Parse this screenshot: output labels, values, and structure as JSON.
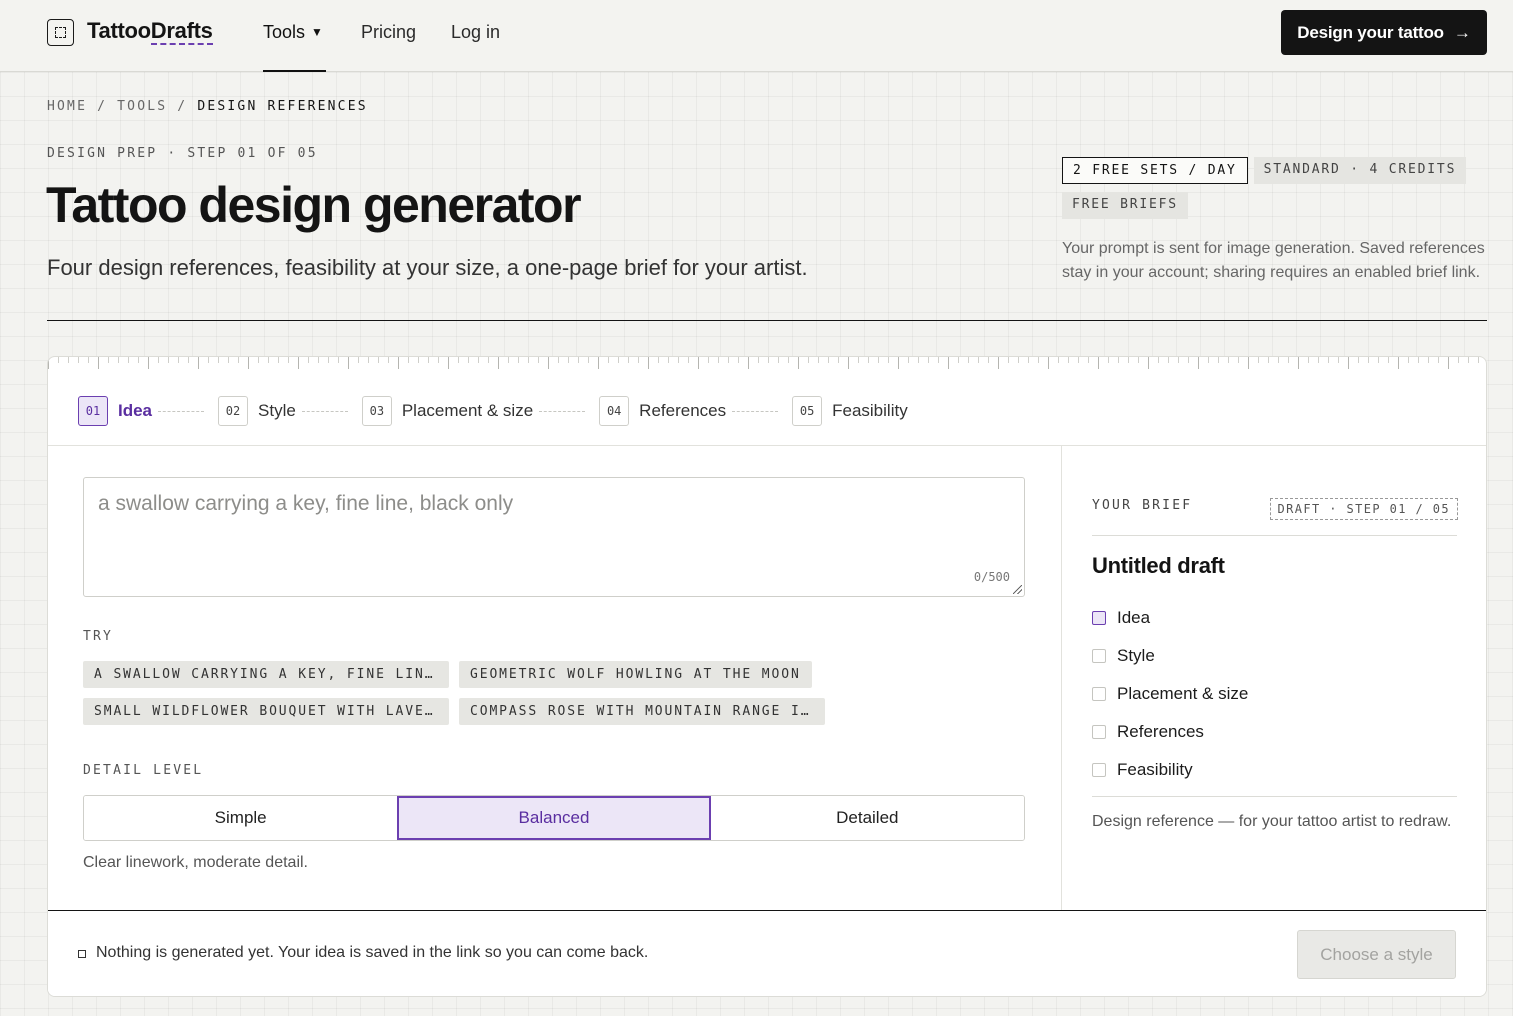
{
  "header": {
    "logo_text": "TattooDrafts",
    "logo_icon": "dashed-frame-icon",
    "nav": {
      "tools": "Tools",
      "pricing": "Pricing",
      "login": "Log in"
    },
    "cta_label": "Design your tattoo",
    "cta_icon": "arrow-right-icon"
  },
  "breadcrumb": [
    "HOME",
    "TOOLS",
    "DESIGN REFERENCES"
  ],
  "hero": {
    "eyebrow": "DESIGN PREP · STEP 01 OF 05",
    "title": "Tattoo design generator",
    "subtitle": "Four design references, feasibility at your size, a one-page brief for your artist.",
    "badges": [
      "2 FREE SETS / DAY",
      "STANDARD · 4 CREDITS",
      "FREE BRIEFS"
    ],
    "privacy_note": "Your prompt is sent for image generation. Saved references stay in your account; sharing requires an enabled brief link."
  },
  "steps": [
    {
      "num": "01",
      "label": "Idea",
      "active": true
    },
    {
      "num": "02",
      "label": "Style",
      "active": false
    },
    {
      "num": "03",
      "label": "Placement & size",
      "active": false
    },
    {
      "num": "04",
      "label": "References",
      "active": false
    },
    {
      "num": "05",
      "label": "Feasibility",
      "active": false
    }
  ],
  "idea": {
    "value": "",
    "placeholder": "a swallow carrying a key, fine line, black only",
    "char_count": "0/500"
  },
  "try": {
    "label": "TRY",
    "chips": [
      "A SWALLOW CARRYING A KEY, FINE LINE, …",
      "GEOMETRIC WOLF HOWLING AT THE MOON",
      "SMALL WILDFLOWER BOUQUET WITH LAVENDE…",
      "COMPASS ROSE WITH MOUNTAIN RANGE INSIDE"
    ]
  },
  "detail": {
    "label": "DETAIL LEVEL",
    "options": [
      "Simple",
      "Balanced",
      "Detailed"
    ],
    "selected": "Balanced",
    "hint": "Clear linework, moderate detail."
  },
  "brief": {
    "heading": "YOUR BRIEF",
    "tag": "DRAFT · STEP 01 / 05",
    "title": "Untitled draft",
    "items": [
      "Idea",
      "Style",
      "Placement & size",
      "References",
      "Feasibility"
    ],
    "footer": "Design reference — for your tattoo artist to redraw."
  },
  "footer": {
    "status": "Nothing is generated yet. Your idea is saved in the link so you can come back.",
    "next_label": "Choose a style"
  },
  "colors": {
    "accent": "#6b3fb0",
    "accent_bg": "#ece6f7",
    "ink": "#141414",
    "page_bg": "#f3f3f0"
  }
}
